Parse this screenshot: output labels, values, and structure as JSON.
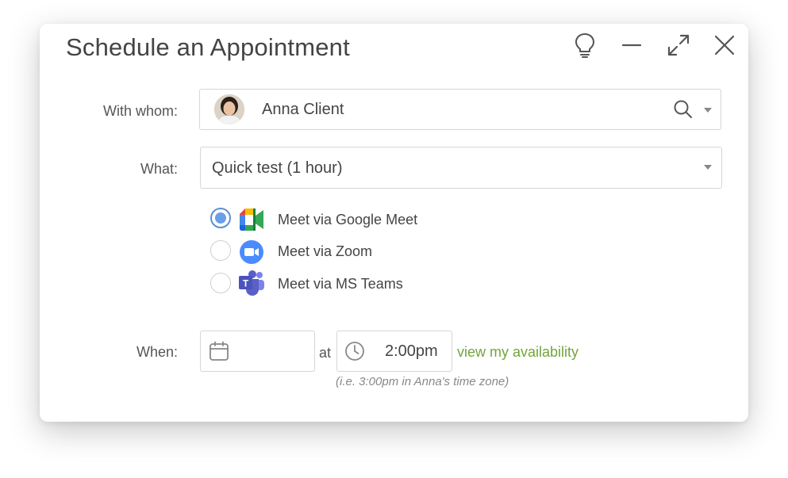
{
  "dialog": {
    "title": "Schedule an Appointment",
    "window_icons": [
      "lightbulb-icon",
      "minimize-icon",
      "expand-icon",
      "close-icon"
    ]
  },
  "with_whom": {
    "label": "With whom:",
    "value": "Anna Client",
    "icons": [
      "avatar",
      "search-icon",
      "chevron-down-icon"
    ]
  },
  "what": {
    "label": "What:",
    "value": "Quick test (1 hour)"
  },
  "meeting_options": [
    {
      "label": "Meet via Google Meet",
      "icon": "google-meet-icon",
      "selected": true
    },
    {
      "label": "Meet via Zoom",
      "icon": "zoom-icon",
      "selected": false
    },
    {
      "label": "Meet via MS Teams",
      "icon": "ms-teams-icon",
      "selected": false
    }
  ],
  "when": {
    "label": "When:",
    "date_value": "",
    "at_label": "at",
    "time_value": "2:00pm",
    "availability_link": "view my availability",
    "timezone_hint": "(i.e. 3:00pm in Anna's time zone)"
  },
  "colors": {
    "accent_link": "#72a53a",
    "radio_selected": "#6a9ee8",
    "zoom_blue": "#4a8cff",
    "teams_purple": "#5b5fc7"
  }
}
